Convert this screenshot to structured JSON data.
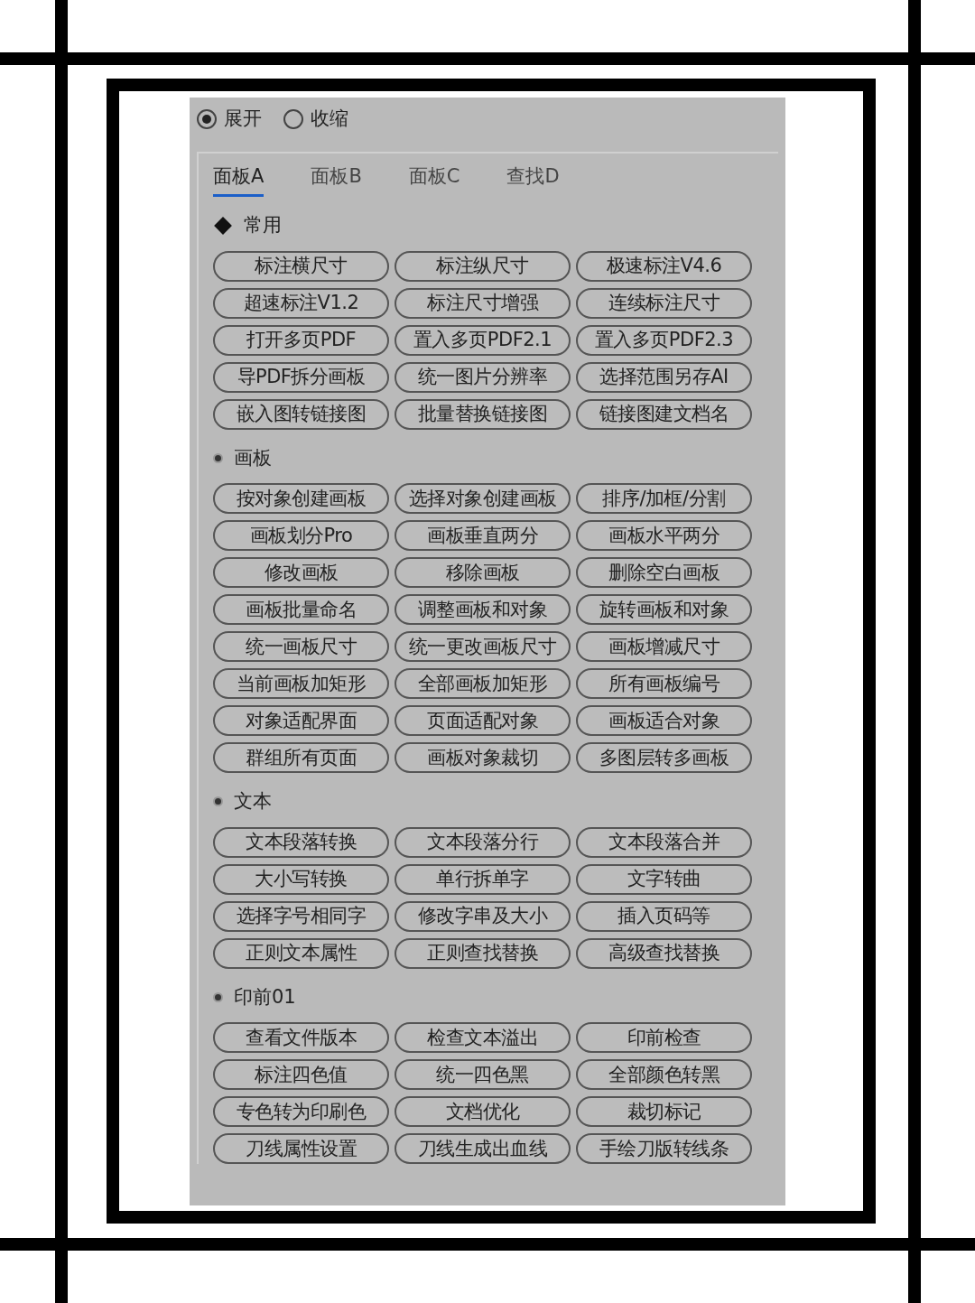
{
  "mode_options": [
    {
      "label": "展开",
      "selected": true
    },
    {
      "label": "收缩",
      "selected": false
    }
  ],
  "tabs": [
    {
      "label": "面板A",
      "selected": true
    },
    {
      "label": "面板B",
      "selected": false
    },
    {
      "label": "面板C",
      "selected": false
    },
    {
      "label": "查找D",
      "selected": false
    }
  ],
  "sections": [
    {
      "title": "常用",
      "kind": "diamond",
      "buttons": [
        "标注横尺寸",
        "标注纵尺寸",
        "极速标注V4.6",
        "超速标注V1.2",
        "标注尺寸增强",
        "连续标注尺寸",
        "打开多页PDF",
        "置入多页PDF2.1",
        "置入多页PDF2.3",
        "导PDF拆分画板",
        "统一图片分辨率",
        "选择范围另存AI",
        "嵌入图转链接图",
        "批量替换链接图",
        "链接图建文档名"
      ]
    },
    {
      "title": "画板",
      "kind": "dot",
      "buttons": [
        "按对象创建画板",
        "选择对象创建画板",
        "排序/加框/分割",
        "画板划分Pro",
        "画板垂直两分",
        "画板水平两分",
        "修改画板",
        "移除画板",
        "删除空白画板",
        "画板批量命名",
        "调整画板和对象",
        "旋转画板和对象",
        "统一画板尺寸",
        "统一更改画板尺寸",
        "画板增减尺寸",
        "当前画板加矩形",
        "全部画板加矩形",
        "所有画板编号",
        "对象适配界面",
        "页面适配对象",
        "画板适合对象",
        "群组所有页面",
        "画板对象裁切",
        "多图层转多画板"
      ]
    },
    {
      "title": "文本",
      "kind": "dot",
      "buttons": [
        "文本段落转换",
        "文本段落分行",
        "文本段落合并",
        "大小写转换",
        "单行拆单字",
        "文字转曲",
        "选择字号相同字",
        "修改字串及大小",
        "插入页码等",
        "正则文本属性",
        "正则查找替换",
        "高级查找替换"
      ]
    },
    {
      "title": "印前01",
      "kind": "dot",
      "buttons": [
        "查看文件版本",
        "检查文本溢出",
        "印前检查",
        "标注四色值",
        "统一四色黑",
        "全部颜色转黑",
        "专色转为印刷色",
        "文档优化",
        "裁切标记",
        "刀线属性设置",
        "刀线生成出血线",
        "手绘刀版转线条"
      ]
    }
  ]
}
